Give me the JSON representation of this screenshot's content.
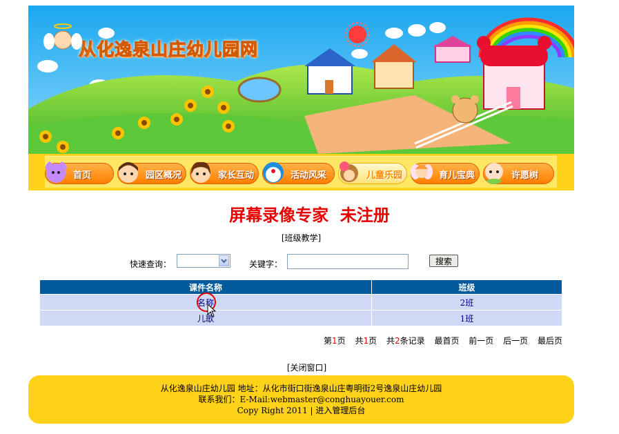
{
  "site": {
    "title": "从化逸泉山庄幼儿园网"
  },
  "nav": {
    "items": [
      {
        "label": "首页"
      },
      {
        "label": "园区概况"
      },
      {
        "label": "家长互动"
      },
      {
        "label": "活动风采"
      },
      {
        "label": "儿童乐园"
      },
      {
        "label": "育儿宝典"
      },
      {
        "label": "许愿树"
      }
    ],
    "active_index": 4
  },
  "watermark": "屏幕录像专家  未注册",
  "section": "[班级教学]",
  "search": {
    "quick_label": "快速查询：",
    "quick_value": "",
    "keyword_label": "关键字：",
    "keyword_value": "",
    "button_label": "搜索"
  },
  "table": {
    "headers": [
      "课件名称",
      "班级"
    ],
    "rows": [
      {
        "name": "名称",
        "class": "2班"
      },
      {
        "name": "儿歌",
        "class": "1班"
      }
    ]
  },
  "pager": {
    "page_prefix": "第",
    "page_current": "1",
    "page_suffix": "页",
    "total_prefix": "共",
    "total_pages": "1",
    "total_suffix": "页",
    "records_prefix": "共",
    "records_count": "2",
    "records_suffix": "条记录",
    "first": "最首页",
    "prev": "前一页",
    "next": "后一页",
    "last": "最后页"
  },
  "close_link": "[关闭窗口]",
  "footer": {
    "line1": "从化逸泉山庄幼儿园  地址：从化市街口街逸泉山庄粤明街2号逸泉山庄幼儿园",
    "line2": "联系我们：E-Mail:webmaster@conghuayouer.com",
    "copyright": "Copy Right 2011 | ",
    "admin_link": "进入管理后台"
  },
  "colors": {
    "banner_yellow": "#ffd21a",
    "table_header": "#005a9c",
    "table_row": "#cfd9f5",
    "watermark_red": "#e60000"
  }
}
